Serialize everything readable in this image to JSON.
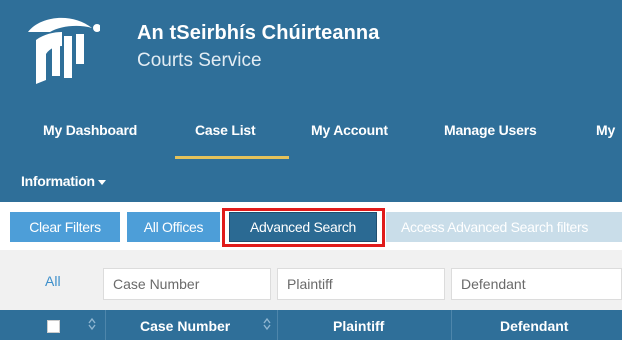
{
  "brand": {
    "title": "An tSeirbhís Chúirteanna",
    "subtitle": "Courts Service",
    "logo_icon": "courts-harp-logo"
  },
  "nav": {
    "items": [
      "My Dashboard",
      "Case List",
      "My Account",
      "Manage Users",
      "My"
    ],
    "active": "Case List",
    "information": "Information"
  },
  "toolbar": {
    "clear_filters": "Clear Filters",
    "all_offices": "All Offices",
    "advanced_search": "Advanced Search",
    "access_filters": "Access Advanced Search filters"
  },
  "filters": {
    "all": "All",
    "case_number_placeholder": "Case Number",
    "plaintiff_placeholder": "Plaintiff",
    "defendant_placeholder": "Defendant"
  },
  "table": {
    "columns": [
      "Case Number",
      "Plaintiff",
      "Defendant"
    ]
  },
  "colors": {
    "header_bg": "#2f6f99",
    "active_underline": "#e5c25a",
    "button_light": "#4d9ed8",
    "button_dark": "#2b6a93",
    "highlight": "#e01b1b"
  }
}
